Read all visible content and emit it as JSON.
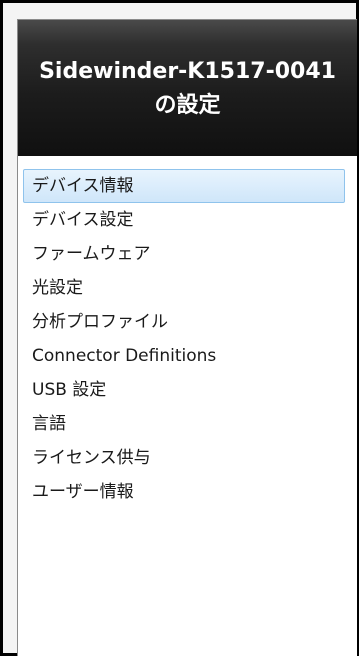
{
  "header": {
    "title": "Sidewinder-K1517-0041 の設定"
  },
  "menu": {
    "selected_index": 0,
    "items": [
      {
        "label": "デバイス情報"
      },
      {
        "label": "デバイス設定"
      },
      {
        "label": "ファームウェア"
      },
      {
        "label": "光設定"
      },
      {
        "label": "分析プロファイル"
      },
      {
        "label": "Connector Definitions"
      },
      {
        "label": "USB 設定"
      },
      {
        "label": "言語"
      },
      {
        "label": "ライセンス供与"
      },
      {
        "label": "ユーザー情報"
      }
    ]
  },
  "colors": {
    "header_bg": "#1c1c1c",
    "header_text": "#ffffff",
    "selected_bg": "#cfe6fa",
    "selected_border": "#8fc3ec"
  }
}
